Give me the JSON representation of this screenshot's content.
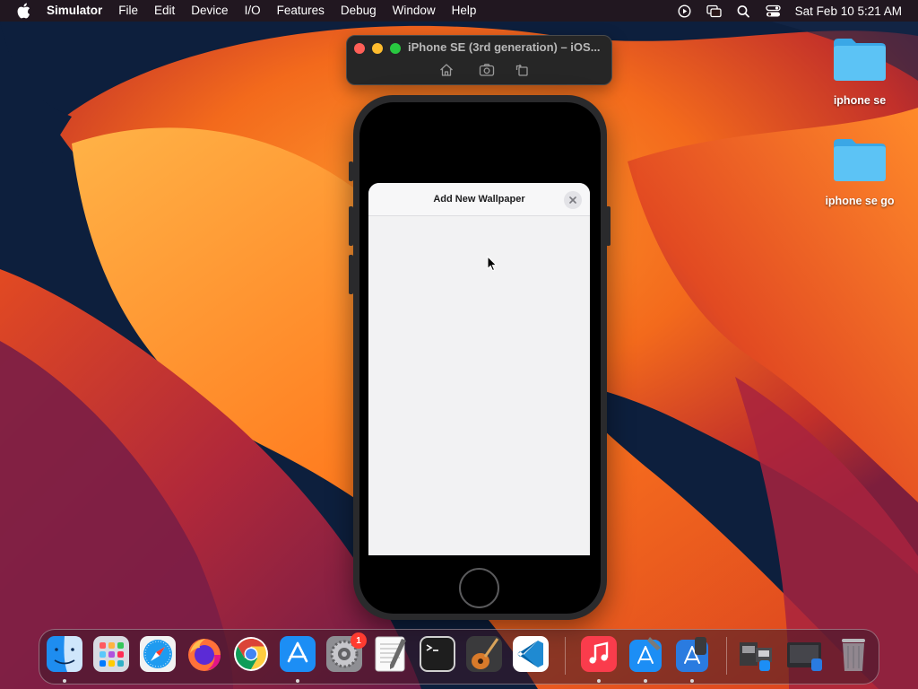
{
  "menubar": {
    "app_name": "Simulator",
    "items": [
      "File",
      "Edit",
      "Device",
      "I/O",
      "Features",
      "Debug",
      "Window",
      "Help"
    ],
    "clock": "Sat Feb 10  5:21 AM",
    "status_icons": [
      "screen-recording-icon",
      "screen-mirroring-icon",
      "spotlight-search-icon",
      "control-center-icon"
    ]
  },
  "simulator": {
    "window_title": "iPhone SE (3rd generation) – iOS...",
    "toolbar_icons": [
      "home-icon",
      "screenshot-icon",
      "rotate-icon"
    ],
    "traffic_lights": {
      "close": "#ff5f57",
      "minimize": "#febc2e",
      "zoom": "#28c840"
    }
  },
  "sheet": {
    "title": "Add New Wallpaper",
    "close_icon": "close-icon"
  },
  "desktop": {
    "folders": [
      {
        "label": "iphone se"
      },
      {
        "label": "iphone se go"
      }
    ],
    "folder_color": "#4fc3f7"
  },
  "dock": {
    "apps": [
      {
        "name": "Finder",
        "icon": "finder-icon",
        "running": true
      },
      {
        "name": "Launchpad",
        "icon": "launchpad-icon",
        "running": false
      },
      {
        "name": "Safari",
        "icon": "safari-icon",
        "running": false
      },
      {
        "name": "Firefox",
        "icon": "firefox-icon",
        "running": false
      },
      {
        "name": "Google Chrome",
        "icon": "chrome-icon",
        "running": false
      },
      {
        "name": "App Store",
        "icon": "app-store-icon",
        "running": true
      },
      {
        "name": "System Settings",
        "icon": "system-settings-icon",
        "running": false,
        "badge": "1"
      },
      {
        "name": "TextEdit",
        "icon": "textedit-icon",
        "running": false
      },
      {
        "name": "Terminal",
        "icon": "terminal-icon",
        "running": false
      },
      {
        "name": "GarageBand",
        "icon": "garageband-icon",
        "running": false
      },
      {
        "name": "Visual Studio Code",
        "icon": "vscode-icon",
        "running": false
      },
      {
        "name": "Music",
        "icon": "music-icon",
        "running": true
      },
      {
        "name": "Xcode",
        "icon": "xcode-icon",
        "running": true
      },
      {
        "name": "Simulator",
        "icon": "simulator-icon",
        "running": true
      },
      {
        "name": "Downloads Stack",
        "icon": "stack-icon",
        "running": false
      },
      {
        "name": "Screenshots Stack",
        "icon": "stack-screens-icon",
        "running": false
      },
      {
        "name": "Trash",
        "icon": "trash-icon",
        "running": false
      }
    ]
  }
}
